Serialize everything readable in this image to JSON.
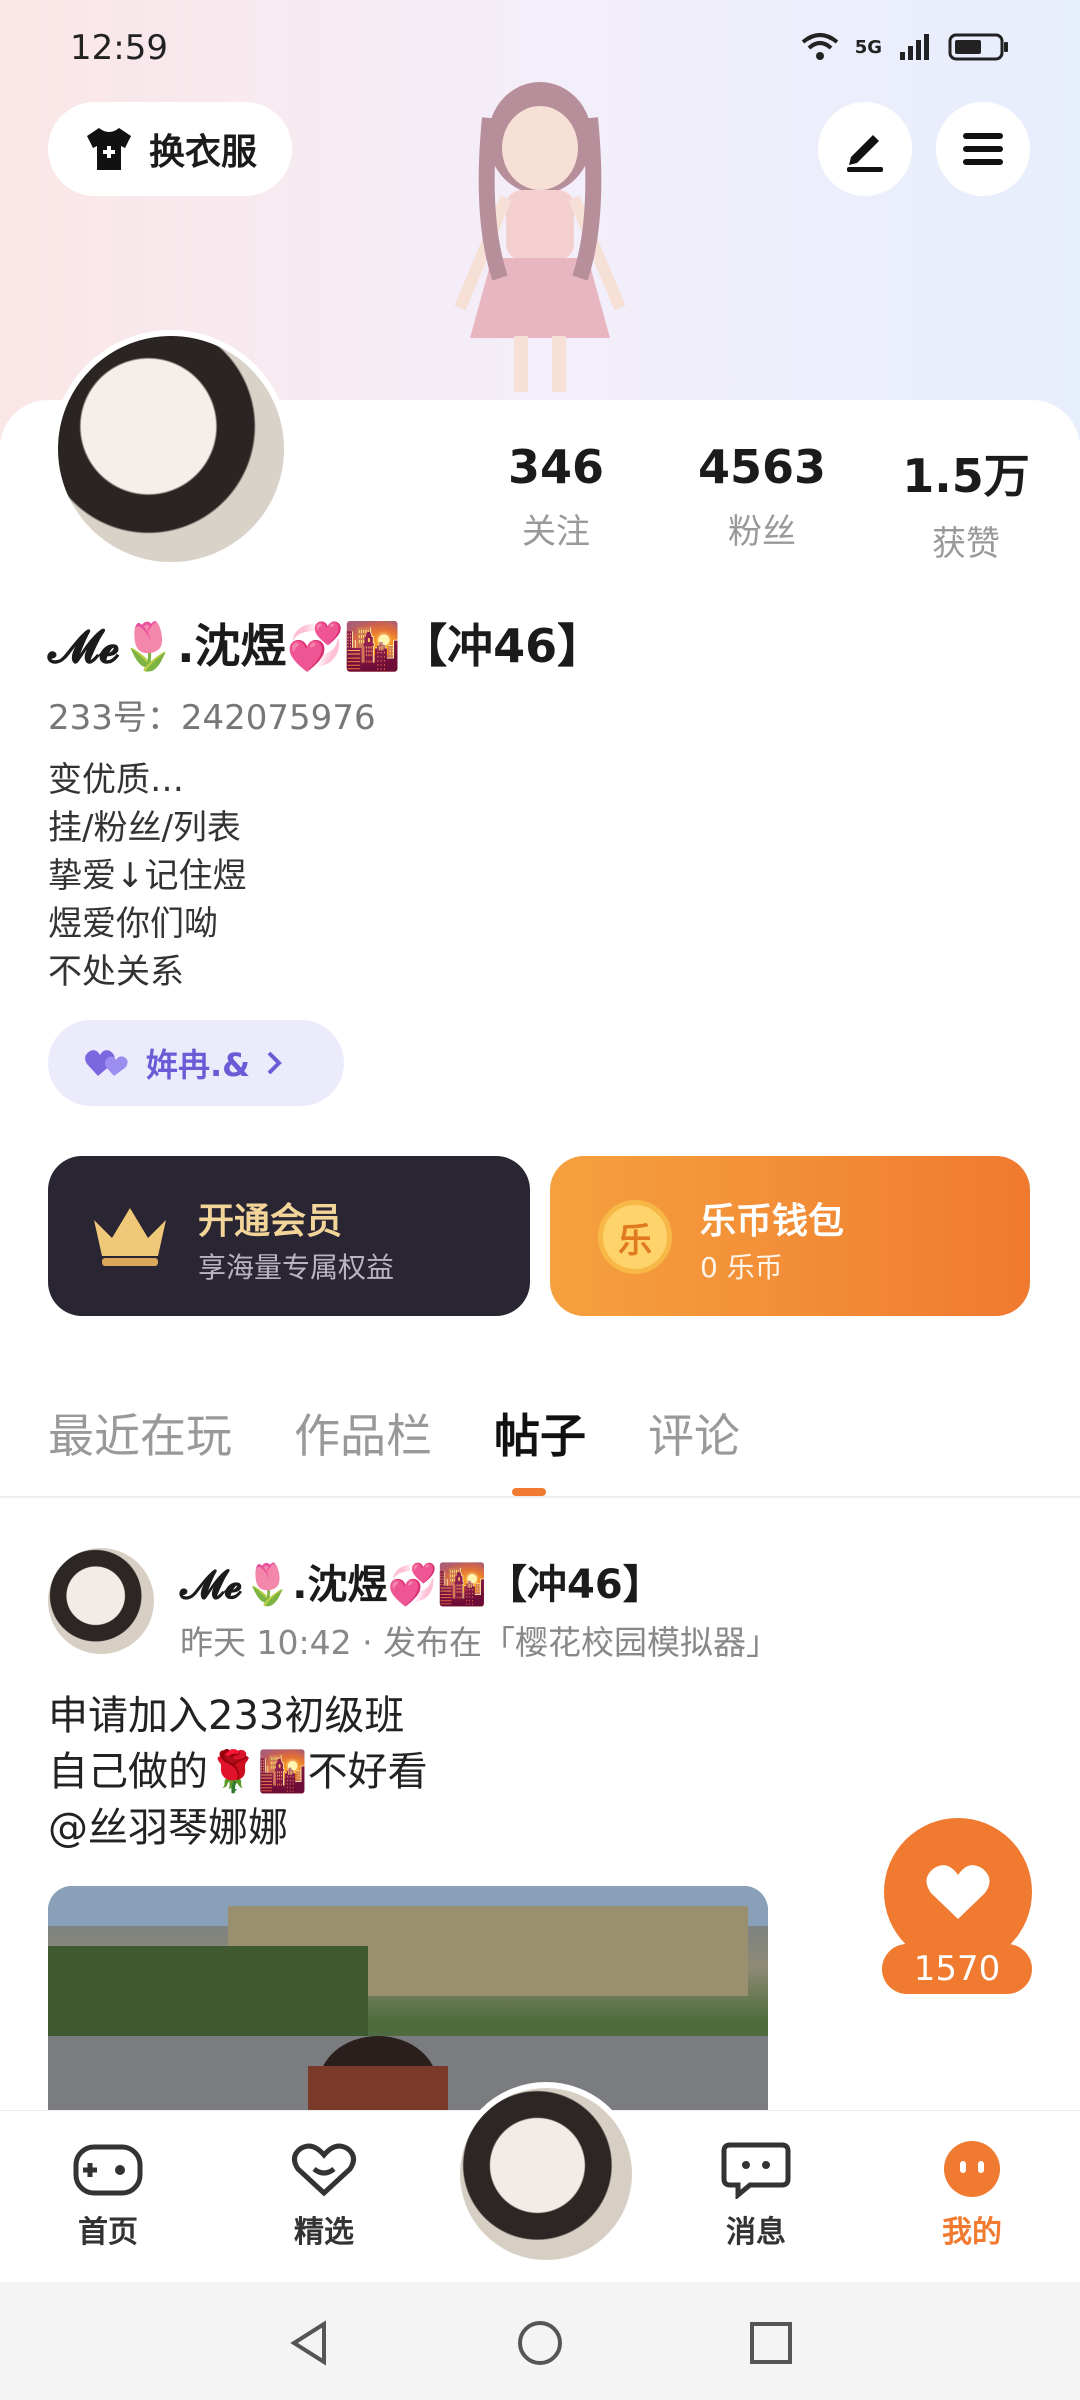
{
  "status": {
    "time": "12:59",
    "network": "5G"
  },
  "header": {
    "outfit_label": "换衣服"
  },
  "stats": [
    {
      "num": "346",
      "label": "关注"
    },
    {
      "num": "4563",
      "label": "粉丝"
    },
    {
      "num": "1.5万",
      "label": "获赞"
    }
  ],
  "profile": {
    "name": "𝓜𝓮🌷.沈煜💞🌇【冲46】",
    "uid": "233号：242075976",
    "bio": [
      "变优质…",
      "挂/粉丝/列表",
      "挚爱↓记住煜",
      "煜爱你们呦",
      "不处关系"
    ],
    "tag": "姩冉.&"
  },
  "cards": {
    "vip_title": "开通会员",
    "vip_sub": "享海量专属权益",
    "wallet_title": "乐币钱包",
    "wallet_sub": "0 乐币",
    "coin_char": "乐"
  },
  "tabs": [
    "最近在玩",
    "作品栏",
    "帖子",
    "评论"
  ],
  "post": {
    "author": "𝓜𝓮🌷.沈煜💞🌇【冲46】",
    "meta": "昨天 10:42 · 发布在「樱花校园模拟器」",
    "lines": [
      "申请加入233初级班",
      "自己做的🌹🌇不好看",
      "@丝羽琴娜娜"
    ],
    "likes": "1570"
  },
  "nav": {
    "home": "首页",
    "featured": "精选",
    "messages": "消息",
    "mine": "我的"
  },
  "colors": {
    "accent": "#f07a2f",
    "vip_bg": "#2a2533",
    "tag_text": "#6b5bd6"
  }
}
